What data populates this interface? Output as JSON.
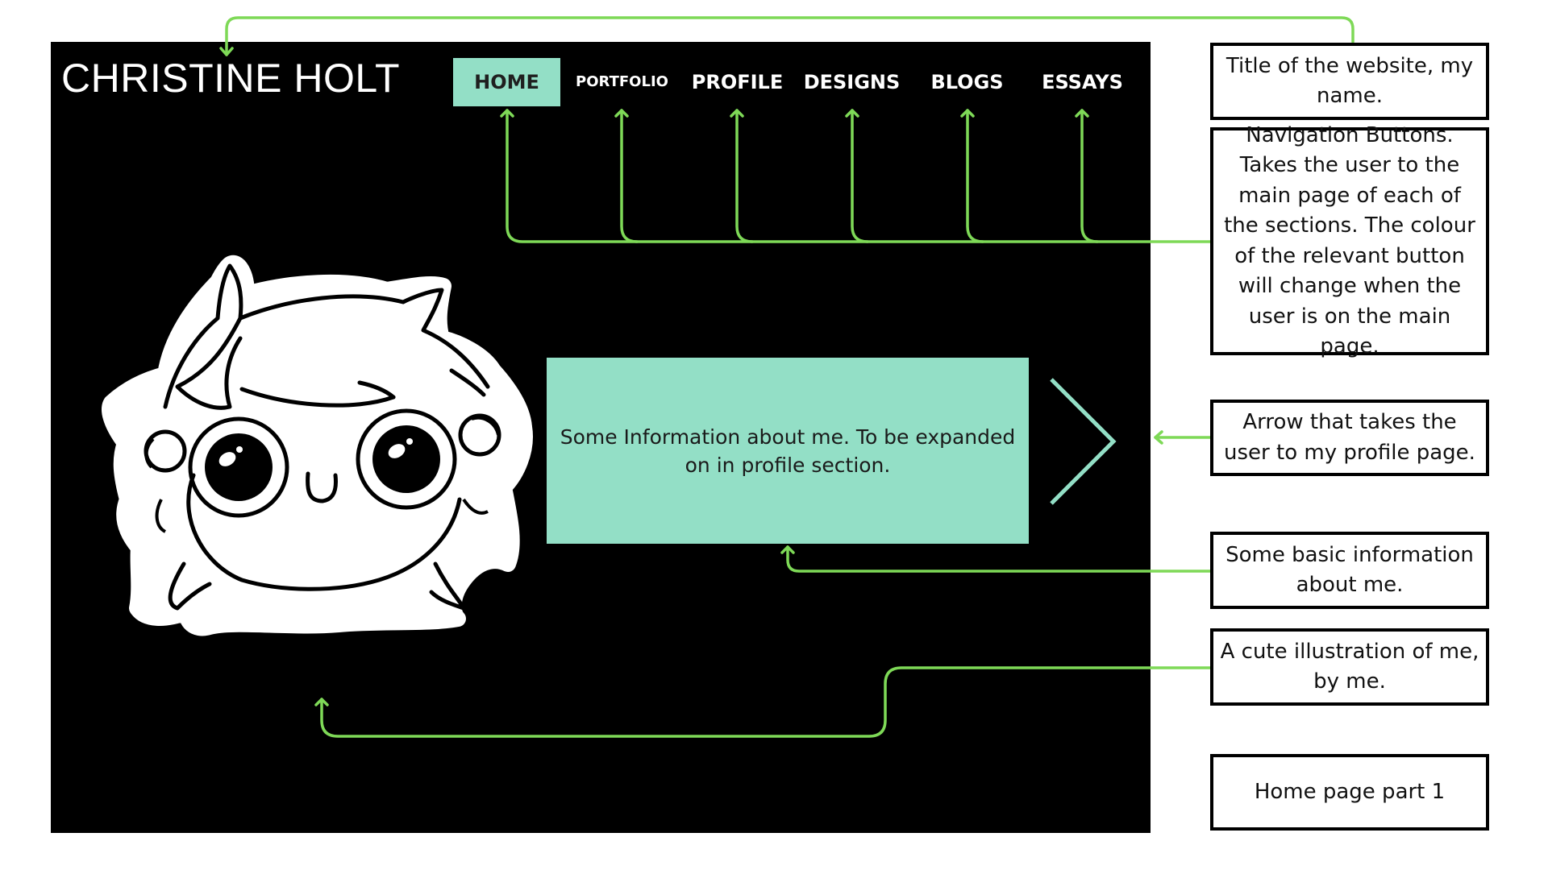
{
  "site": {
    "title": "CHRISTINE HOLT"
  },
  "nav": {
    "items": [
      {
        "label": "HOME",
        "active": true
      },
      {
        "label": "PORTFOLIO",
        "active": false
      },
      {
        "label": "PROFILE",
        "active": false
      },
      {
        "label": "DESIGNS",
        "active": false
      },
      {
        "label": "BLOGS",
        "active": false
      },
      {
        "label": "ESSAYS",
        "active": false
      }
    ]
  },
  "info_box": {
    "text": "Some Information about me. To be expanded on in profile section."
  },
  "annotations": {
    "title_note": "Title of the website, my name.",
    "nav_note": "Navigation Buttons. Takes the user to the main page of each of the sections. The colour of the relevant button will change when the user is on the main page.",
    "arrow_note": "Arrow that takes the user to my profile page.",
    "info_note": "Some basic information about me.",
    "illustration_note": "A cute illustration of me, by me.",
    "page_label": "Home page part 1"
  },
  "colors": {
    "accent": "#93dfc6",
    "connector": "#7ed957",
    "background": "#000000"
  },
  "icons": {
    "profile_arrow": "chevron-right-icon",
    "illustration": "cartoon-self-portrait"
  }
}
